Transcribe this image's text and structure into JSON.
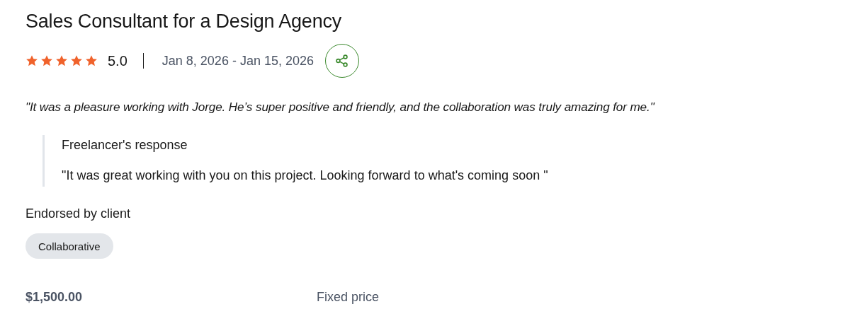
{
  "title": "Sales Consultant for a Design Agency",
  "rating": {
    "stars": 5,
    "score": "5.0",
    "dates": "Jan 8, 2026 - Jan 15, 2026"
  },
  "review": "\"It was a pleasure working with Jorge. He’s super positive and friendly, and the collaboration was truly amazing for me.\"",
  "response": {
    "heading": "Freelancer's response",
    "text": "\"It was great working with you on this project. Looking forward to what's coming soon \""
  },
  "endorsed": {
    "label": "Endorsed by client",
    "tags": [
      "Collaborative"
    ]
  },
  "price": {
    "amount": "$1,500.00",
    "type": "Fixed price"
  }
}
